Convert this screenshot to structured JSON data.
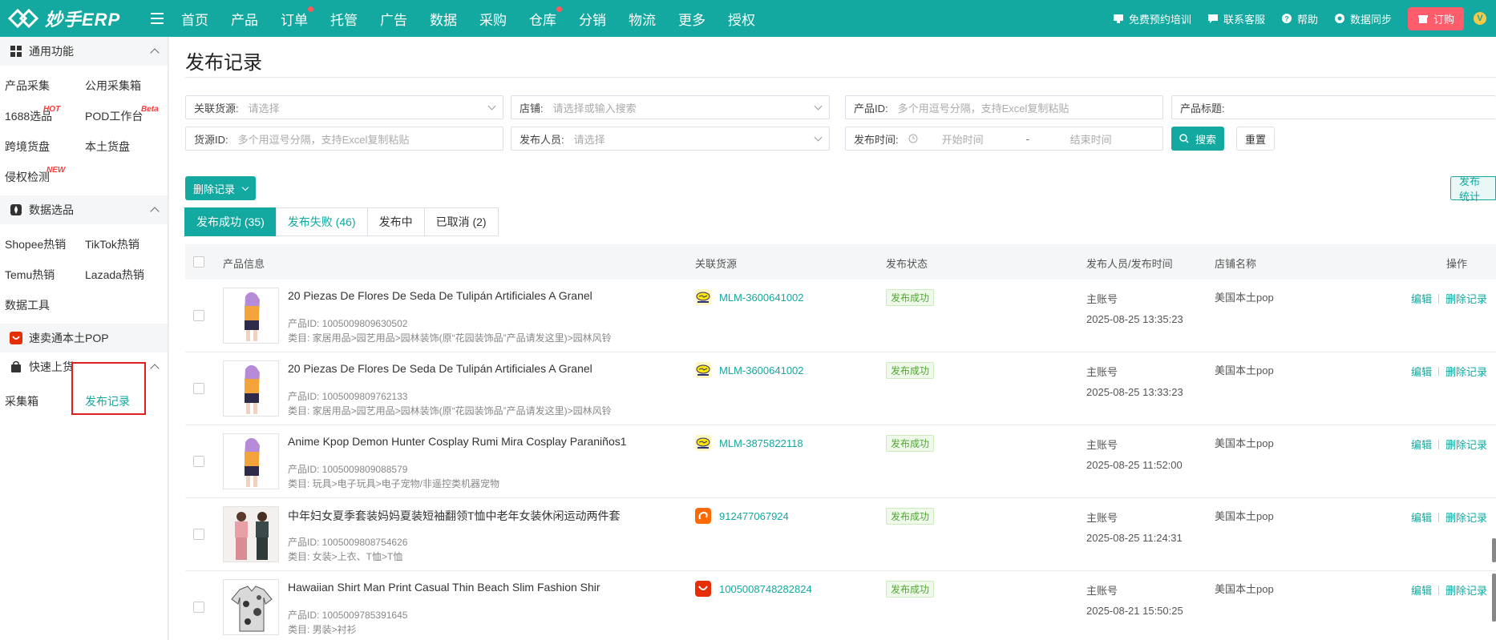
{
  "brand": {
    "name": "妙手ERP",
    "accent": "#13a8a0"
  },
  "nav": [
    {
      "label": "首页",
      "dot": false
    },
    {
      "label": "产品",
      "dot": false
    },
    {
      "label": "订单",
      "dot": true
    },
    {
      "label": "托管",
      "dot": false
    },
    {
      "label": "广告",
      "dot": false
    },
    {
      "label": "数据",
      "dot": false
    },
    {
      "label": "采购",
      "dot": false
    },
    {
      "label": "仓库",
      "dot": true
    },
    {
      "label": "分销",
      "dot": false
    },
    {
      "label": "物流",
      "dot": false
    },
    {
      "label": "更多",
      "dot": false
    },
    {
      "label": "授权",
      "dot": false
    }
  ],
  "topRight": {
    "training": "免费预约培训",
    "support": "联系客服",
    "help": "帮助",
    "sync": "数据同步",
    "order": "订购",
    "avatar_initial": "V"
  },
  "sidebar": {
    "sections": [
      {
        "title": "通用功能",
        "icon": "grid-icon"
      },
      {
        "title": "数据选品",
        "icon": "fire-icon"
      },
      {
        "title": "速卖通本土POP",
        "icon": "aliexpress-icon"
      },
      {
        "title": "快速上货",
        "icon": "bag-icon"
      }
    ],
    "general": [
      {
        "label": "产品采集",
        "tag": ""
      },
      {
        "label": "公用采集箱",
        "tag": ""
      },
      {
        "label": "1688选品",
        "tag": "HOT"
      },
      {
        "label": "POD工作台",
        "tag": "Beta"
      },
      {
        "label": "跨境货盘",
        "tag": ""
      },
      {
        "label": "本土货盘",
        "tag": ""
      },
      {
        "label": "侵权检测",
        "tag": "NEW"
      }
    ],
    "data": [
      {
        "label": "Shopee热销"
      },
      {
        "label": "TikTok热销"
      },
      {
        "label": "Temu热销"
      },
      {
        "label": "Lazada热销"
      },
      {
        "label": "数据工具"
      }
    ],
    "quick": [
      {
        "label": "采集箱"
      },
      {
        "label": "发布记录"
      }
    ]
  },
  "page": {
    "title": "发布记录"
  },
  "filters": {
    "source": {
      "label": "关联货源:",
      "placeholder": "请选择"
    },
    "shop": {
      "label": "店铺:",
      "placeholder": "请选择或输入搜索"
    },
    "productId": {
      "label": "产品ID:",
      "placeholder": "多个用逗号分隔，支持Excel复制粘贴"
    },
    "productTitle": {
      "label": "产品标题:",
      "placeholder": ""
    },
    "sourceId": {
      "label": "货源ID:",
      "placeholder": "多个用逗号分隔，支持Excel复制粘贴"
    },
    "publisher": {
      "label": "发布人员:",
      "placeholder": "请选择"
    },
    "publishTime": {
      "label": "发布时间:",
      "start": "开始时间",
      "sep": "-",
      "end": "结束时间"
    },
    "search": "搜索",
    "reset": "重置"
  },
  "actions": {
    "delete": "删除记录",
    "stats": "发布统计"
  },
  "tabs": [
    {
      "label": "发布成功 (35)"
    },
    {
      "label": "发布失败 (46)"
    },
    {
      "label": "发布中"
    },
    {
      "label": "已取消 (2)"
    }
  ],
  "table": {
    "headers": {
      "product": "产品信息",
      "source": "关联货源",
      "status": "发布状态",
      "publisher": "发布人员/发布时间",
      "shop": "店铺名称",
      "ops": "操作"
    },
    "rows": [
      {
        "name": "20 Piezas De Flores De Seda De Tulipán Artificiales A Granel",
        "pid": "产品ID: 1005009809630502",
        "category": "类目: 家居用品>园艺用品>园林装饰(原“花园装饰品”产品请发这里)>园林风铃",
        "source": "MLM-3600641002",
        "source_type": "mercadolibre",
        "status": "发布成功",
        "publisher": "主账号",
        "time": "2025-08-25 13:35:23",
        "shop": "美国本土pop",
        "thumb": "costume"
      },
      {
        "name": "20 Piezas De Flores De Seda De Tulipán Artificiales A Granel",
        "pid": "产品ID: 1005009809762133",
        "category": "类目: 家居用品>园艺用品>园林装饰(原“花园装饰品”产品请发这里)>园林风铃",
        "source": "MLM-3600641002",
        "source_type": "mercadolibre",
        "status": "发布成功",
        "publisher": "主账号",
        "time": "2025-08-25 13:33:23",
        "shop": "美国本土pop",
        "thumb": "costume"
      },
      {
        "name": "Anime Kpop Demon Hunter Cosplay Rumi Mira Cosplay Paraniños1",
        "pid": "产品ID: 1005009809088579",
        "category": "类目: 玩具>电子玩具>电子宠物/非遥控类机器宠物",
        "source": "MLM-3875822118",
        "source_type": "mercadolibre",
        "status": "发布成功",
        "publisher": "主账号",
        "time": "2025-08-25 11:52:00",
        "shop": "美国本土pop",
        "thumb": "costume"
      },
      {
        "name": "中年妇女夏季套装妈妈夏装短袖翻领T恤中老年女装休闲运动两件套",
        "pid": "产品ID: 1005009808754626",
        "category": "类目: 女装>上衣、T恤>T恤",
        "source": "912477067924",
        "source_type": "taobao",
        "status": "发布成功",
        "publisher": "主账号",
        "time": "2025-08-25 11:24:31",
        "shop": "美国本土pop",
        "thumb": "women"
      },
      {
        "name": "Hawaiian Shirt Man Print Casual Thin Beach Slim Fashion Shir",
        "pid": "产品ID: 1005009785391645",
        "category": "类目: 男装>衬衫",
        "source": "1005008748282824",
        "source_type": "aliexpress",
        "status": "发布成功",
        "publisher": "主账号",
        "time": "2025-08-21 15:50:25",
        "shop": "美国本土pop",
        "thumb": "shirt"
      }
    ],
    "ops": {
      "edit": "编辑",
      "delete": "删除记录"
    }
  }
}
